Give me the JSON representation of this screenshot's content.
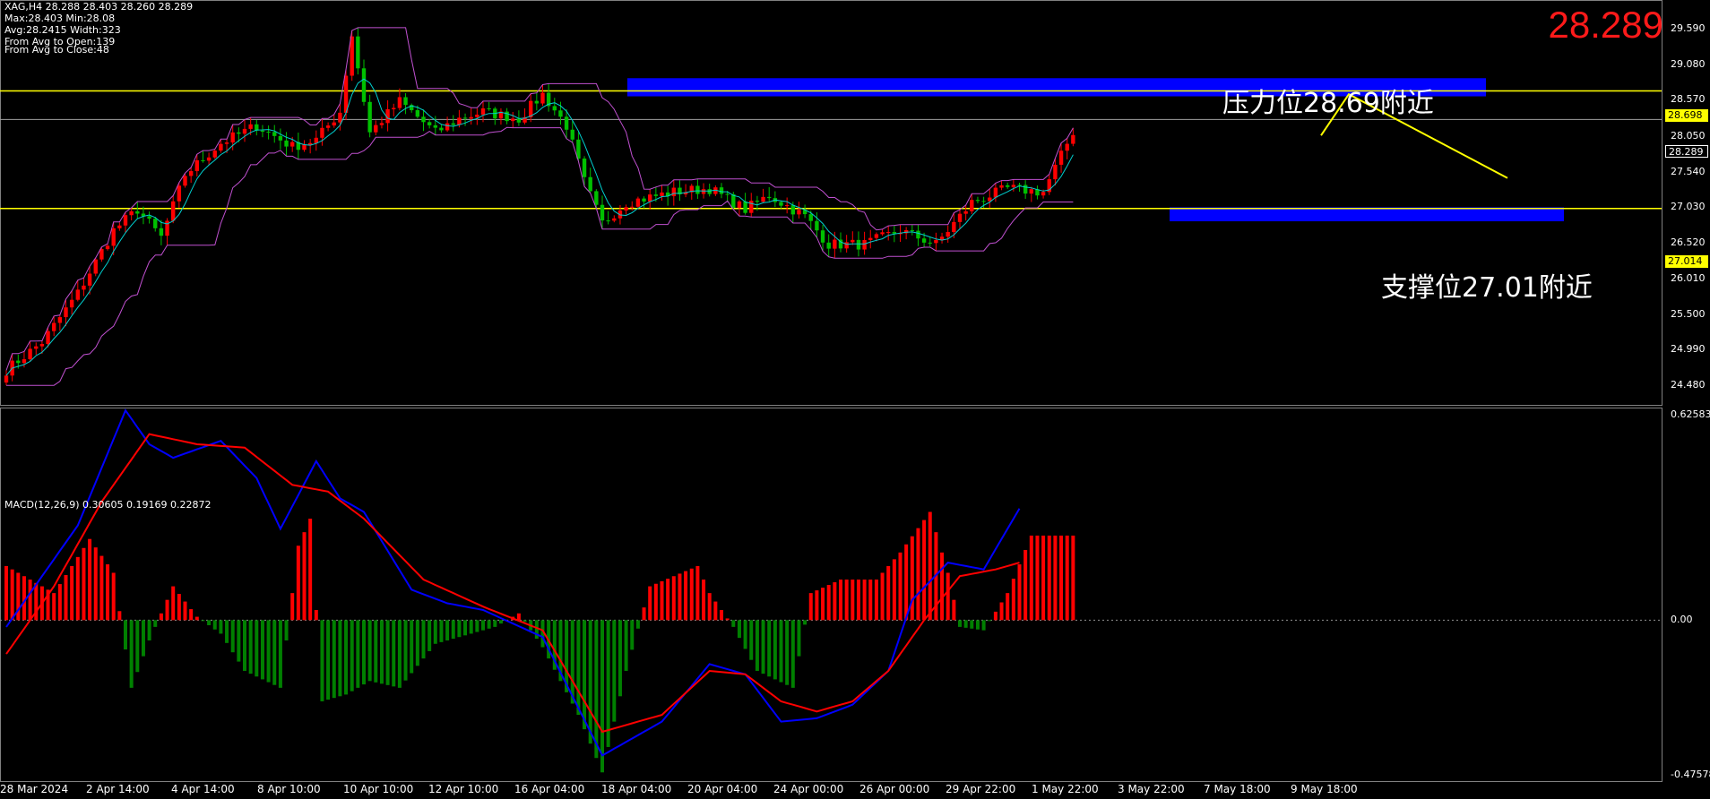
{
  "header": {
    "symbol_line": "XAG,H4  28.288 28.403 28.260 28.289",
    "stats": [
      "Max:28.403 Min:28.08",
      "Avg:28.2415 Width:323",
      "From Avg to Open:139",
      "From Avg to Close:48"
    ],
    "current_price": "28.289"
  },
  "annotations": {
    "resistance": "压力位28.69附近",
    "support": "支撑位27.01附近"
  },
  "macd_label": "MACD(12,26,9) 0.30605 0.19169 0.22872",
  "price_tags": {
    "resistance": "28.698",
    "current": "28.289",
    "support": "27.014"
  },
  "colors": {
    "bull": "#ff0000",
    "bear": "#00c000",
    "macd_line": "#0000ff",
    "signal_line": "#ff0000",
    "zone": "#0000ff",
    "hline": "#ffff00",
    "channel": "#c050d0"
  },
  "chart_data": [
    {
      "type": "candlestick",
      "symbol": "XAG",
      "timeframe": "H4",
      "ylim": [
        24.2,
        30.0
      ],
      "y_ticks": [
        "29.590",
        "29.080",
        "28.570",
        "28.050",
        "27.540",
        "27.030",
        "26.520",
        "26.010",
        "25.500",
        "24.990",
        "24.480"
      ],
      "x_ticks": [
        "28 Mar 2024",
        "2 Apr 14:00",
        "4 Apr 14:00",
        "8 Apr 10:00",
        "10 Apr 10:00",
        "12 Apr 10:00",
        "16 Apr 04:00",
        "18 Apr 04:00",
        "20 Apr 04:00",
        "24 Apr 00:00",
        "26 Apr 00:00",
        "29 Apr 22:00",
        "1 May 22:00",
        "3 May 22:00",
        "7 May 18:00",
        "9 May 18:00"
      ],
      "close_path": [
        [
          0,
          24.7
        ],
        [
          6,
          25.1
        ],
        [
          12,
          25.8
        ],
        [
          18,
          26.7
        ],
        [
          22,
          27.0
        ],
        [
          26,
          26.6
        ],
        [
          30,
          27.5
        ],
        [
          36,
          27.95
        ],
        [
          42,
          28.2
        ],
        [
          48,
          27.9
        ],
        [
          52,
          28.0
        ],
        [
          56,
          28.4
        ],
        [
          58,
          29.5
        ],
        [
          61,
          28.1
        ],
        [
          66,
          28.55
        ],
        [
          72,
          28.1
        ],
        [
          76,
          28.3
        ],
        [
          80,
          28.4
        ],
        [
          86,
          28.3
        ],
        [
          90,
          28.65
        ],
        [
          94,
          28.2
        ],
        [
          97,
          27.4
        ],
        [
          100,
          26.8
        ],
        [
          104,
          27.1
        ],
        [
          112,
          27.25
        ],
        [
          118,
          27.3
        ],
        [
          124,
          27.0
        ],
        [
          128,
          27.2
        ],
        [
          134,
          26.9
        ],
        [
          138,
          26.5
        ],
        [
          144,
          26.5
        ],
        [
          150,
          26.7
        ],
        [
          156,
          26.5
        ],
        [
          162,
          27.1
        ],
        [
          168,
          27.3
        ],
        [
          174,
          27.25
        ],
        [
          180,
          28.289
        ]
      ],
      "horizontal_levels": {
        "resistance": 28.698,
        "current": 28.289,
        "support": 27.014
      },
      "zones": {
        "resistance": [
          28.62,
          28.88
        ],
        "support": [
          26.83,
          27.03
        ]
      },
      "projection": [
        [
          28.06,
          0
        ],
        [
          28.65,
          1
        ],
        [
          27.45,
          2
        ]
      ]
    },
    {
      "type": "bar_line",
      "name": "MACD(12,26,9)",
      "ylim": [
        -0.47578,
        0.62583
      ],
      "y_ticks": [
        "0.62583",
        "0.00",
        "-0.47578"
      ],
      "macd_path": [
        [
          0,
          -0.02
        ],
        [
          12,
          0.28
        ],
        [
          20,
          0.62
        ],
        [
          24,
          0.52
        ],
        [
          28,
          0.48
        ],
        [
          36,
          0.53
        ],
        [
          42,
          0.42
        ],
        [
          46,
          0.27
        ],
        [
          52,
          0.47
        ],
        [
          56,
          0.36
        ],
        [
          60,
          0.32
        ],
        [
          68,
          0.09
        ],
        [
          74,
          0.05
        ],
        [
          80,
          0.03
        ],
        [
          90,
          -0.05
        ],
        [
          100,
          -0.4
        ],
        [
          110,
          -0.3
        ],
        [
          118,
          -0.13
        ],
        [
          124,
          -0.16
        ],
        [
          130,
          -0.3
        ],
        [
          136,
          -0.29
        ],
        [
          142,
          -0.25
        ],
        [
          148,
          -0.15
        ],
        [
          152,
          0.06
        ],
        [
          158,
          0.17
        ],
        [
          164,
          0.15
        ],
        [
          170,
          0.33
        ]
      ],
      "signal_path": [
        [
          0,
          -0.1
        ],
        [
          8,
          0.1
        ],
        [
          16,
          0.35
        ],
        [
          24,
          0.55
        ],
        [
          32,
          0.52
        ],
        [
          40,
          0.51
        ],
        [
          48,
          0.4
        ],
        [
          54,
          0.38
        ],
        [
          60,
          0.3
        ],
        [
          70,
          0.12
        ],
        [
          80,
          0.04
        ],
        [
          90,
          -0.03
        ],
        [
          100,
          -0.33
        ],
        [
          110,
          -0.28
        ],
        [
          118,
          -0.15
        ],
        [
          124,
          -0.16
        ],
        [
          130,
          -0.24
        ],
        [
          136,
          -0.27
        ],
        [
          142,
          -0.24
        ],
        [
          148,
          -0.15
        ],
        [
          154,
          0.0
        ],
        [
          160,
          0.13
        ],
        [
          166,
          0.15
        ],
        [
          170,
          0.17
        ]
      ],
      "histogram_path": [
        [
          0,
          0.16
        ],
        [
          8,
          0.08
        ],
        [
          14,
          0.24
        ],
        [
          18,
          0.14
        ],
        [
          21,
          -0.2
        ],
        [
          24,
          -0.06
        ],
        [
          28,
          0.1
        ],
        [
          32,
          0.01
        ],
        [
          36,
          -0.04
        ],
        [
          40,
          -0.15
        ],
        [
          46,
          -0.2
        ],
        [
          49,
          0.22
        ],
        [
          51,
          0.3
        ],
        [
          53,
          -0.24
        ],
        [
          57,
          -0.22
        ],
        [
          61,
          -0.18
        ],
        [
          66,
          -0.2
        ],
        [
          72,
          -0.07
        ],
        [
          78,
          -0.04
        ],
        [
          82,
          -0.02
        ],
        [
          86,
          0.02
        ],
        [
          90,
          -0.08
        ],
        [
          96,
          -0.28
        ],
        [
          100,
          -0.45
        ],
        [
          104,
          -0.15
        ],
        [
          108,
          0.1
        ],
        [
          116,
          0.16
        ],
        [
          118,
          0.08
        ],
        [
          122,
          -0.02
        ],
        [
          126,
          -0.15
        ],
        [
          132,
          -0.2
        ],
        [
          135,
          0.08
        ],
        [
          140,
          0.12
        ],
        [
          146,
          0.12
        ],
        [
          150,
          0.2
        ],
        [
          155,
          0.32
        ],
        [
          158,
          0.14
        ],
        [
          160,
          -0.02
        ],
        [
          164,
          -0.03
        ],
        [
          168,
          0.08
        ],
        [
          172,
          0.25
        ]
      ]
    }
  ]
}
